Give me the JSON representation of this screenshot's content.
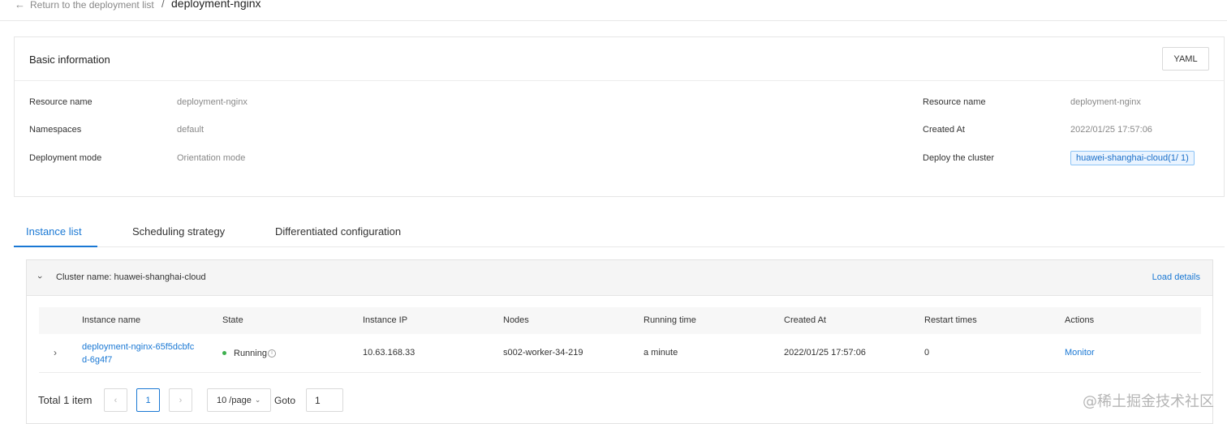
{
  "breadcrumb": {
    "back_label": "Return to the deployment list",
    "separator": "/",
    "current": "deployment-nginx"
  },
  "basic_info": {
    "title": "Basic information",
    "yaml_button": "YAML",
    "left": [
      {
        "label": "Resource name",
        "value": "deployment-nginx"
      },
      {
        "label": "Namespaces",
        "value": "default"
      },
      {
        "label": "Deployment mode",
        "value": "Orientation mode"
      }
    ],
    "right": [
      {
        "label": "Resource name",
        "value": "deployment-nginx"
      },
      {
        "label": "Created At",
        "value": "2022/01/25 17:57:06"
      },
      {
        "label": "Deploy the cluster",
        "value": "huawei-shanghai-cloud(1/ 1)"
      }
    ]
  },
  "tabs": [
    {
      "label": "Instance list",
      "active": true
    },
    {
      "label": "Scheduling strategy",
      "active": false
    },
    {
      "label": "Differentiated configuration",
      "active": false
    }
  ],
  "cluster_panel": {
    "name_label": "Cluster name: huawei-shanghai-cloud",
    "load_details": "Load details",
    "columns": [
      "Instance name",
      "State",
      "Instance IP",
      "Nodes",
      "Running time",
      "Created At",
      "Restart times",
      "Actions"
    ],
    "rows": [
      {
        "instance_name_line1": "deployment-nginx-65f5dcbfc",
        "instance_name_line2": "d-6g4f7",
        "state": "Running",
        "ip": "10.63.168.33",
        "node": "s002-worker-34-219",
        "running_time": "a minute",
        "created_at": "2022/01/25 17:57:06",
        "restart_times": "0",
        "action": "Monitor"
      }
    ]
  },
  "pagination": {
    "total": "Total 1 item",
    "prev": "‹",
    "current_page": "1",
    "next": "›",
    "page_size": "10 /page",
    "goto_label": "Goto",
    "goto_value": "1"
  },
  "watermark": "@稀土掘金技术社区",
  "colors": {
    "accent": "#1a78d4",
    "status_running": "#3eb04f",
    "tag_bg": "#eaf4ff"
  }
}
